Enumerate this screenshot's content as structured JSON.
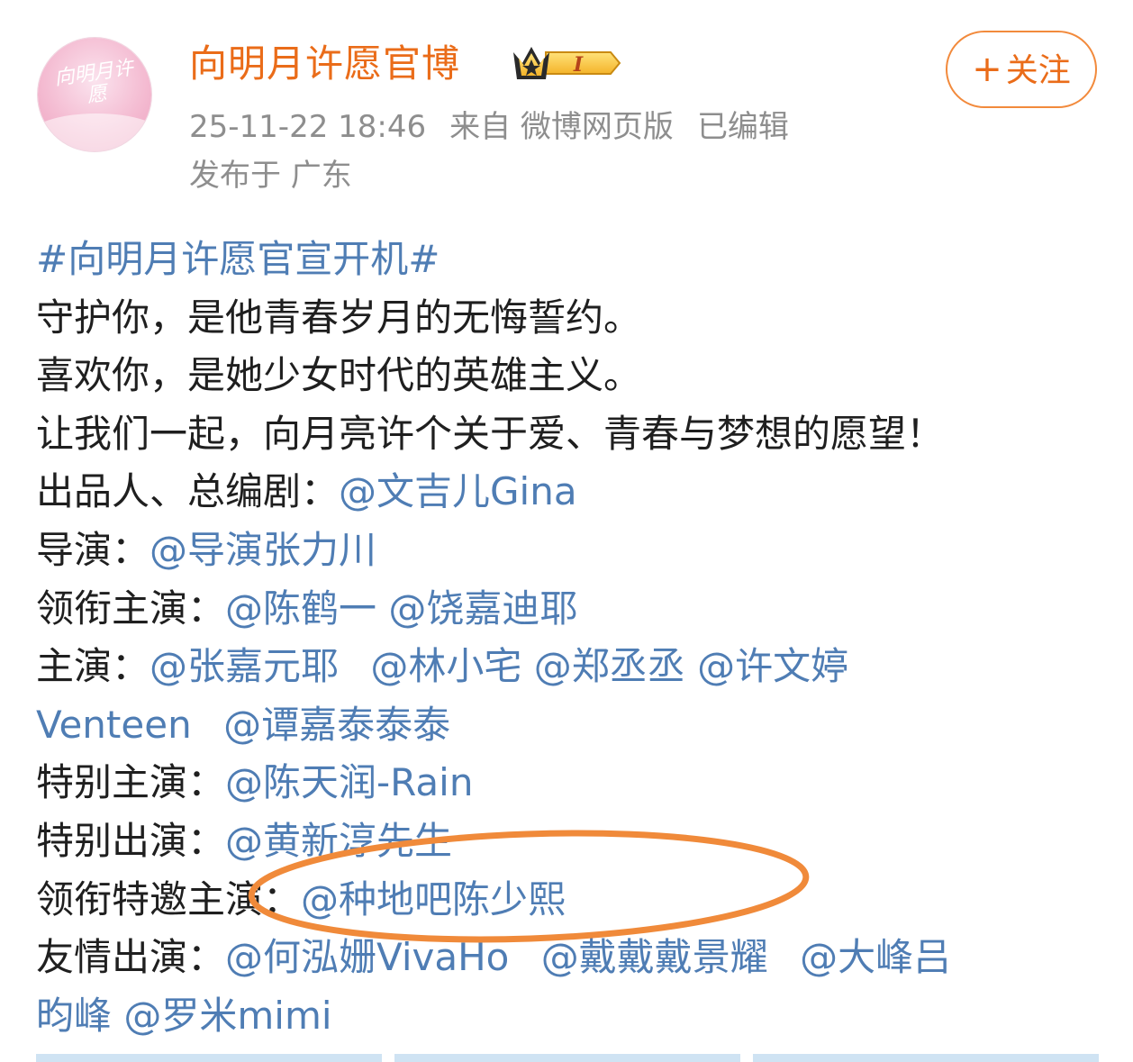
{
  "post": {
    "author": "向明月许愿官博",
    "avatar_text": "向明月许愿",
    "timestamp": "25-11-22 18:46",
    "source": "来自 微博网页版",
    "edited": "已编辑",
    "location": "发布于 广东",
    "follow_label": "关注",
    "follow_icon": "+",
    "vip_badge_text": "I"
  },
  "content": {
    "hashtag": "#向明月许愿官宣开机#",
    "line1": "守护你，是他青春岁月的无悔誓约。",
    "line2": "喜欢你，是她少女时代的英雄主义。",
    "line3": "让我们一起，向月亮许个关于爱、青春与梦想的愿望！",
    "producer_label": "出品人、总编剧：",
    "producer": "@文吉儿Gina",
    "director_label": "导演：",
    "director": "@导演张力川",
    "lead_label": "领衔主演：",
    "lead": [
      "@陈鹤一",
      "@饶嘉迪耶"
    ],
    "cast_label": "主演：",
    "cast_line1": [
      "@张嘉元耶",
      "@林小宅",
      "@郑丞丞",
      "@许文婷"
    ],
    "cast_line2": [
      "Venteen",
      "@谭嘉泰泰泰"
    ],
    "special_label": "特别主演：",
    "special": "@陈天润-Rain",
    "special_appear_label": "特别出演：",
    "special_appear": "@黄新淳先生",
    "guest_lead_label": "领衔特邀主演：",
    "guest_lead": "@种地吧陈少熙",
    "friend_label": "友情出演：",
    "friend_line1": [
      "@何泓姗VivaHo",
      "@戴戴戴景耀",
      "@大峰吕"
    ],
    "friend_line2": [
      "昀峰",
      "@罗米mimi"
    ]
  },
  "colors": {
    "accent": "#ea6c19",
    "link": "#4f7db4",
    "meta": "#8e8e8e",
    "annotation": "#f08a3a"
  },
  "icons": [
    "crown-icon",
    "plus-icon"
  ]
}
